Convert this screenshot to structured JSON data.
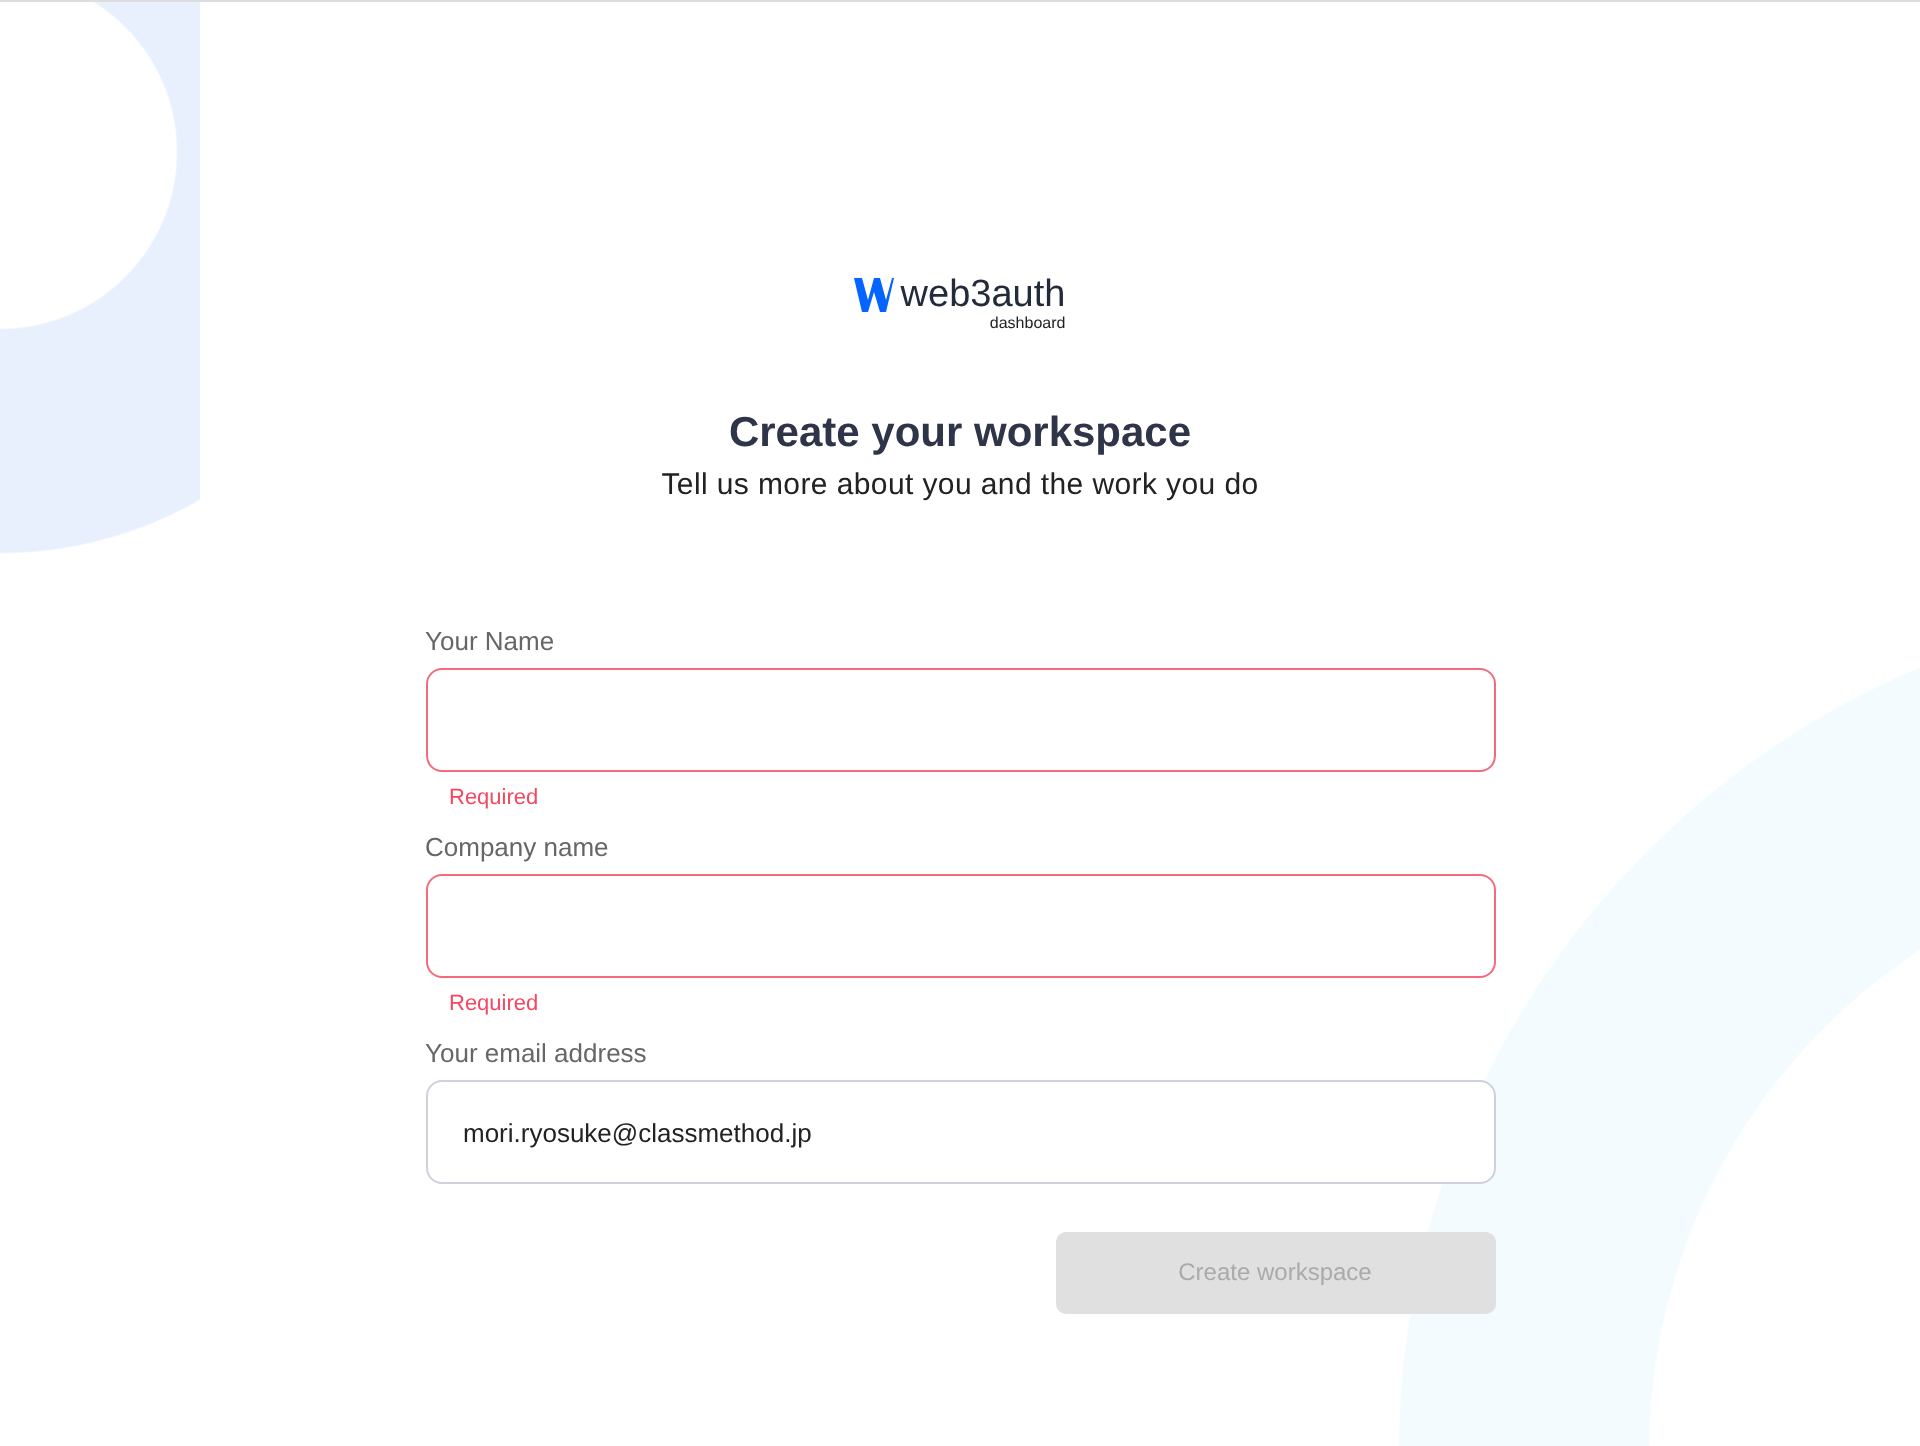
{
  "logo": {
    "name": "web3auth",
    "subtitle": "dashboard"
  },
  "heading": {
    "title": "Create your workspace",
    "subtitle": "Tell us more about you and the work you do"
  },
  "fields": [
    {
      "label": "Your Name",
      "invalid": true,
      "error": "Required"
    },
    {
      "label": "Company name",
      "invalid": true,
      "error": "Required"
    },
    {
      "label": "Your email address",
      "value": "mori.ryosuke@classmethod.jp",
      "invalid": false
    }
  ],
  "submit": {
    "label": "Create workspace",
    "disabled": true
  }
}
